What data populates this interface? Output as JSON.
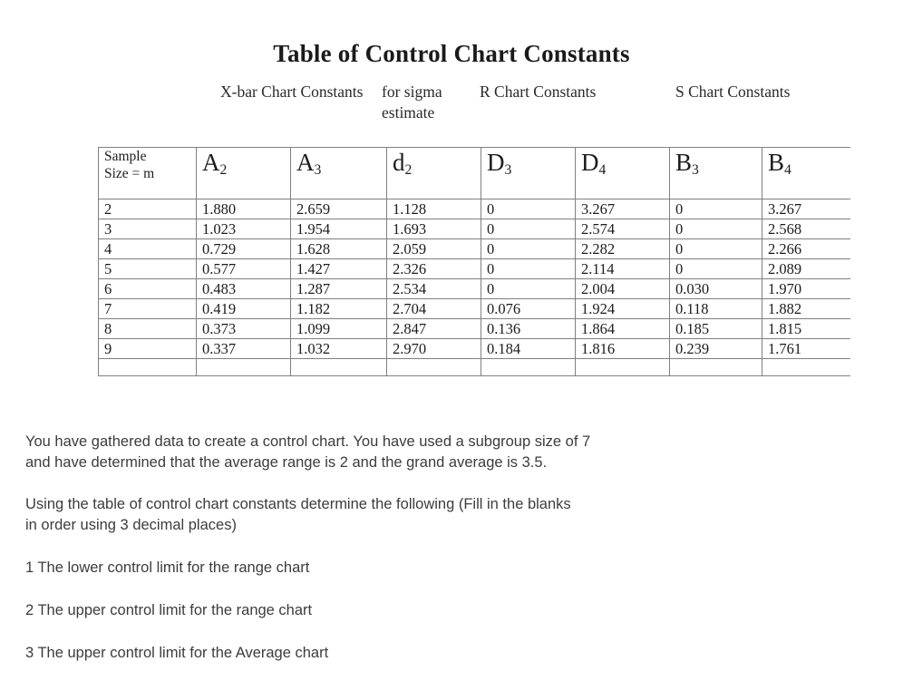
{
  "title": "Table of Control Chart Constants",
  "group_headers": {
    "xbar": "X-bar Chart Constants",
    "sigma": "for sigma estimate",
    "rchart": "R Chart Constants",
    "schart": "S Chart Constants"
  },
  "chart_data": {
    "type": "table",
    "title": "Table of Control Chart Constants",
    "columns": [
      "Sample Size = m",
      "A2",
      "A3",
      "d2",
      "D3",
      "D4",
      "B3",
      "B4"
    ],
    "column_groups": [
      {
        "label": "X-bar Chart Constants",
        "columns": [
          "A2",
          "A3"
        ]
      },
      {
        "label": "for sigma estimate",
        "columns": [
          "d2"
        ]
      },
      {
        "label": "R Chart Constants",
        "columns": [
          "D3",
          "D4"
        ]
      },
      {
        "label": "S Chart Constants",
        "columns": [
          "B3",
          "B4"
        ]
      }
    ],
    "rows": [
      [
        "2",
        "1.880",
        "2.659",
        "1.128",
        "0",
        "3.267",
        "0",
        "3.267"
      ],
      [
        "3",
        "1.023",
        "1.954",
        "1.693",
        "0",
        "2.574",
        "0",
        "2.568"
      ],
      [
        "4",
        "0.729",
        "1.628",
        "2.059",
        "0",
        "2.282",
        "0",
        "2.266"
      ],
      [
        "5",
        "0.577",
        "1.427",
        "2.326",
        "0",
        "2.114",
        "0",
        "2.089"
      ],
      [
        "6",
        "0.483",
        "1.287",
        "2.534",
        "0",
        "2.004",
        "0.030",
        "1.970"
      ],
      [
        "7",
        "0.419",
        "1.182",
        "2.704",
        "0.076",
        "1.924",
        "0.118",
        "1.882"
      ],
      [
        "8",
        "0.373",
        "1.099",
        "2.847",
        "0.136",
        "1.864",
        "0.185",
        "1.815"
      ],
      [
        "9",
        "0.337",
        "1.032",
        "2.970",
        "0.184",
        "1.816",
        "0.239",
        "1.761"
      ]
    ]
  },
  "table": {
    "header": {
      "size_label": "Sample\nSize = m",
      "symbols": [
        {
          "base": "A",
          "sub": "2"
        },
        {
          "base": "A",
          "sub": "3"
        },
        {
          "base": "d",
          "sub": "2"
        },
        {
          "base": "D",
          "sub": "3"
        },
        {
          "base": "D",
          "sub": "4"
        },
        {
          "base": "B",
          "sub": "3"
        },
        {
          "base": "B",
          "sub": "4"
        }
      ]
    },
    "rows": [
      {
        "m": "2",
        "A2": "1.880",
        "A3": "2.659",
        "d2": "1.128",
        "D3": "0",
        "D4": "3.267",
        "B3": "0",
        "B4": "3.267"
      },
      {
        "m": "3",
        "A2": "1.023",
        "A3": "1.954",
        "d2": "1.693",
        "D3": "0",
        "D4": "2.574",
        "B3": "0",
        "B4": "2.568"
      },
      {
        "m": "4",
        "A2": "0.729",
        "A3": "1.628",
        "d2": "2.059",
        "D3": "0",
        "D4": "2.282",
        "B3": "0",
        "B4": "2.266"
      },
      {
        "m": "5",
        "A2": "0.577",
        "A3": "1.427",
        "d2": "2.326",
        "D3": "0",
        "D4": "2.114",
        "B3": "0",
        "B4": "2.089"
      },
      {
        "m": "6",
        "A2": "0.483",
        "A3": "1.287",
        "d2": "2.534",
        "D3": "0",
        "D4": "2.004",
        "B3": "0.030",
        "B4": "1.970"
      },
      {
        "m": "7",
        "A2": "0.419",
        "A3": "1.182",
        "d2": "2.704",
        "D3": "0.076",
        "D4": "1.924",
        "B3": "0.118",
        "B4": "1.882"
      },
      {
        "m": "8",
        "A2": "0.373",
        "A3": "1.099",
        "d2": "2.847",
        "D3": "0.136",
        "D4": "1.864",
        "B3": "0.185",
        "B4": "1.815"
      },
      {
        "m": "9",
        "A2": "0.337",
        "A3": "1.032",
        "d2": "2.970",
        "D3": "0.184",
        "D4": "1.816",
        "B3": "0.239",
        "B4": "1.761"
      }
    ]
  },
  "prose": {
    "intro_line1": "You have gathered data to create a control chart. You have used a subgroup size of 7",
    "intro_line2": "and have determined that the average range is 2 and the grand average is 3.5.",
    "instruction_line1": "Using the table of control chart constants determine the following (Fill in the blanks",
    "instruction_line2": "in order using 3 decimal places)",
    "questions": [
      "1 The lower control limit for the range chart",
      "2 The upper control limit for the range chart",
      "3 The upper control limit for the Average chart"
    ]
  }
}
